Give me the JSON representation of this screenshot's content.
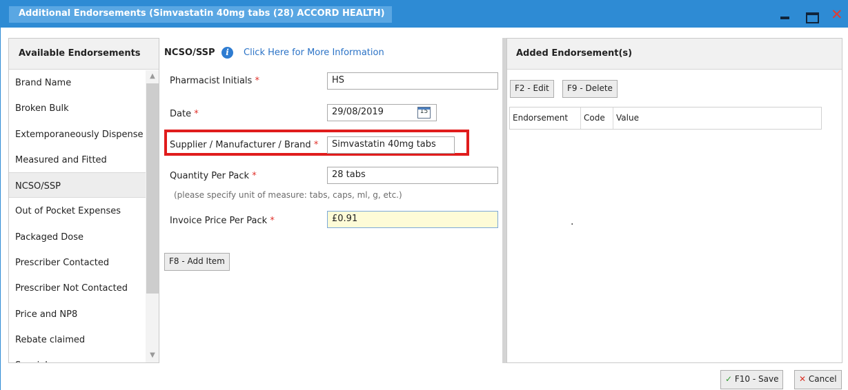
{
  "window": {
    "title": "Additional Endorsements (Simvastatin 40mg tabs (28) ACCORD HEALTH)",
    "controls": {
      "minimize": "minimize-icon",
      "maximize": "maximize-icon",
      "close": "✕"
    }
  },
  "left_panel": {
    "header": "Available Endorsements",
    "items": [
      "Brand Name",
      "Broken Bulk",
      "Extemporaneously Dispense",
      "Measured and Fitted",
      "NCSO/SSP",
      "Out of Pocket Expenses",
      "Packaged Dose",
      "Prescriber Contacted",
      "Prescriber Not Contacted",
      "Price and NP8",
      "Rebate claimed",
      "Specials"
    ],
    "selected": "NCSO/SSP"
  },
  "middle_panel": {
    "header": "NCSO/SSP",
    "info_icon": "i",
    "info_link": "Click Here for More Information",
    "required_mark": "*",
    "fields": {
      "pharmacist_initials": {
        "label": "Pharmacist Initials",
        "value": "HS"
      },
      "date": {
        "label": "Date",
        "value": "29/08/2019",
        "calendar_day": "15"
      },
      "supplier": {
        "label": "Supplier / Manufacturer / Brand",
        "value": "Simvastatin 40mg tabs"
      },
      "quantity": {
        "label": "Quantity Per Pack",
        "value": "28 tabs",
        "hint": "(please specify unit of measure: tabs, caps, ml, g, etc.)"
      },
      "invoice_price": {
        "label": "Invoice Price Per Pack",
        "value": "£0.91"
      }
    },
    "add_button": "F8 - Add Item"
  },
  "right_panel": {
    "header": "Added Endorsement(s)",
    "edit_button": "F2 - Edit",
    "delete_button": "F9 - Delete",
    "columns": [
      "Endorsement",
      "Code",
      "Value"
    ],
    "dot": "·"
  },
  "footer": {
    "save_icon": "✓",
    "save_label": "F10 - Save",
    "cancel_icon": "✕",
    "cancel_label": "Cancel"
  },
  "colors": {
    "titlebar": "#2e8bd4",
    "highlight_box": "#e01c1c",
    "link": "#2a72c6",
    "required": "#e0312a"
  }
}
